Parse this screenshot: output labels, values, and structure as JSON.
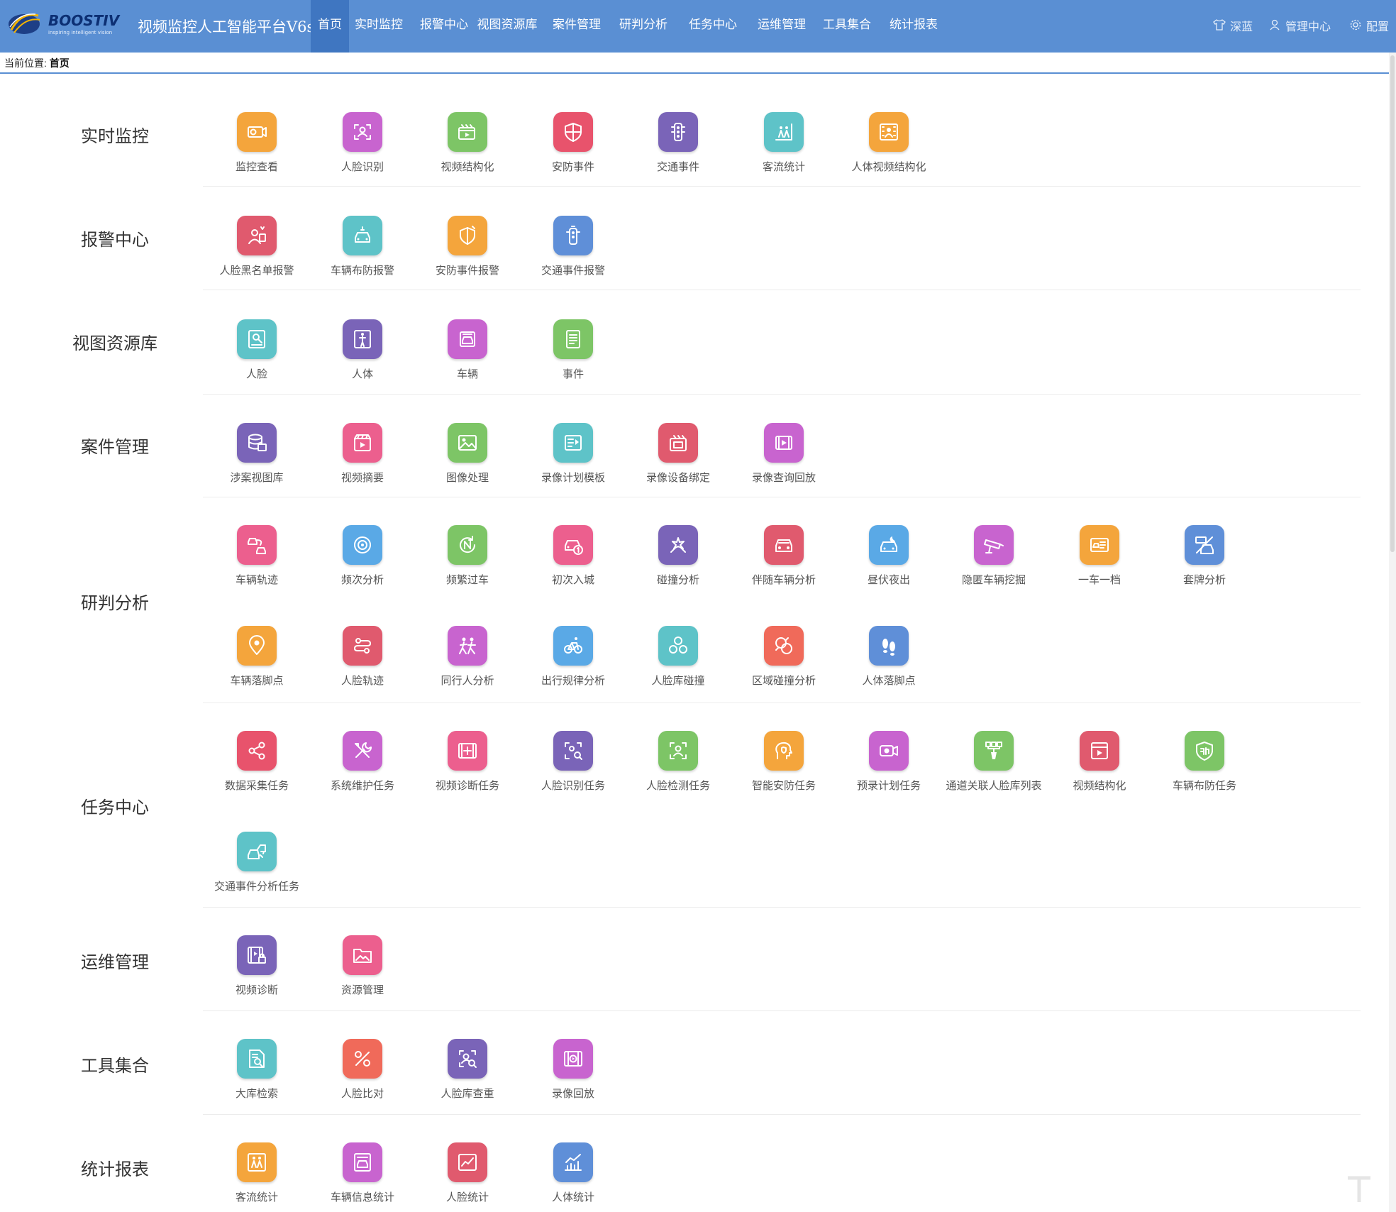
{
  "app": {
    "logo_text": "BOOSTIV",
    "logo_tagline": "inspiring intelligent vision",
    "title": "视频监控人工智能平台V6s"
  },
  "nav": {
    "tabs": [
      "首页",
      "实时监控",
      "报警中心",
      "视图资源库",
      "案件管理",
      "研判分析",
      "任务中心",
      "运维管理",
      "工具集合",
      "统计报表"
    ],
    "active_index": 0
  },
  "top_links": [
    {
      "label": "深蓝",
      "icon": "shirt-icon"
    },
    {
      "label": "管理中心",
      "icon": "user-icon"
    },
    {
      "label": "配置",
      "icon": "gear-icon"
    }
  ],
  "breadcrumb": {
    "prefix": "当前位置:",
    "current": "首页"
  },
  "colors": {
    "topbar": "#5a8fd3",
    "active_tab": "#3f76c1"
  },
  "sections": [
    {
      "title": "实时监控",
      "items": [
        {
          "label": "监控查看",
          "color": "#f4a53c",
          "icon": "camera-icon"
        },
        {
          "label": "人脸识别",
          "color": "#c864cf",
          "icon": "face-scan-icon"
        },
        {
          "label": "视频结构化",
          "color": "#7dc566",
          "icon": "video-structure-icon"
        },
        {
          "label": "安防事件",
          "color": "#e8536c",
          "icon": "shield-icon"
        },
        {
          "label": "交通事件",
          "color": "#7a64b8",
          "icon": "traffic-light-icon"
        },
        {
          "label": "客流统计",
          "color": "#5ec3c8",
          "icon": "crowd-icon"
        },
        {
          "label": "人体视频结构化",
          "color": "#f4a53c",
          "icon": "person-grid-icon"
        }
      ]
    },
    {
      "title": "报警中心",
      "items": [
        {
          "label": "人脸黑名单报警",
          "color": "#e05a6e",
          "icon": "person-alarm-icon"
        },
        {
          "label": "车辆布防报警",
          "color": "#5ec3c8",
          "icon": "car-alarm-icon"
        },
        {
          "label": "安防事件报警",
          "color": "#f4a53c",
          "icon": "shield-alarm-icon"
        },
        {
          "label": "交通事件报警",
          "color": "#5f8fd8",
          "icon": "traffic-alarm-icon"
        }
      ]
    },
    {
      "title": "视图资源库",
      "items": [
        {
          "label": "人脸",
          "color": "#5ec3c8",
          "icon": "face-card-icon"
        },
        {
          "label": "人体",
          "color": "#7a64b8",
          "icon": "person-body-icon"
        },
        {
          "label": "车辆",
          "color": "#c864cf",
          "icon": "vehicle-icon"
        },
        {
          "label": "事件",
          "color": "#7dc566",
          "icon": "list-icon"
        }
      ]
    },
    {
      "title": "案件管理",
      "items": [
        {
          "label": "涉案视图库",
          "color": "#7a64b8",
          "icon": "database-icon"
        },
        {
          "label": "视频摘要",
          "color": "#ec5f8e",
          "icon": "clapper-icon"
        },
        {
          "label": "图像处理",
          "color": "#7dc566",
          "icon": "image-icon"
        },
        {
          "label": "录像计划模板",
          "color": "#5ec3c8",
          "icon": "template-icon"
        },
        {
          "label": "录像设备绑定",
          "color": "#e05a6e",
          "icon": "device-bind-icon"
        },
        {
          "label": "录像查询回放",
          "color": "#c864cf",
          "icon": "film-play-icon"
        }
      ]
    },
    {
      "title": "研判分析",
      "items": [
        {
          "label": "车辆轨迹",
          "color": "#ec5f8e",
          "icon": "car-track-icon"
        },
        {
          "label": "频次分析",
          "color": "#5aa9e6",
          "icon": "frequency-icon"
        },
        {
          "label": "频繁过车",
          "color": "#7dc566",
          "icon": "n-cycle-icon"
        },
        {
          "label": "初次入城",
          "color": "#ec5f8e",
          "icon": "car-first-icon"
        },
        {
          "label": "碰撞分析",
          "color": "#7a64b8",
          "icon": "collision-icon"
        },
        {
          "label": "伴随车辆分析",
          "color": "#e05a6e",
          "icon": "car-follow-icon"
        },
        {
          "label": "昼伏夜出",
          "color": "#5aa9e6",
          "icon": "car-night-icon"
        },
        {
          "label": "隐匿车辆挖掘",
          "color": "#c864cf",
          "icon": "cctv-icon"
        },
        {
          "label": "一车一档",
          "color": "#f4a53c",
          "icon": "car-file-icon"
        },
        {
          "label": "套牌分析",
          "color": "#5f8fd8",
          "icon": "fake-plate-icon"
        },
        {
          "label": "车辆落脚点",
          "color": "#f4a53c",
          "icon": "location-pin-icon"
        },
        {
          "label": "人脸轨迹",
          "color": "#e05a6e",
          "icon": "face-track-icon"
        },
        {
          "label": "同行人分析",
          "color": "#c864cf",
          "icon": "companions-icon"
        },
        {
          "label": "出行规律分析",
          "color": "#5aa9e6",
          "icon": "bicycle-icon"
        },
        {
          "label": "人脸库碰撞",
          "color": "#5ec3c8",
          "icon": "face-group-icon"
        },
        {
          "label": "区域碰撞分析",
          "color": "#f06a5a",
          "icon": "area-collision-icon"
        },
        {
          "label": "人体落脚点",
          "color": "#5f8fd8",
          "icon": "footprints-icon"
        }
      ]
    },
    {
      "title": "任务中心",
      "items": [
        {
          "label": "数据采集任务",
          "color": "#e8536c",
          "icon": "share-nodes-icon"
        },
        {
          "label": "系统维护任务",
          "color": "#c864cf",
          "icon": "tools-icon"
        },
        {
          "label": "视频诊断任务",
          "color": "#ec5f8e",
          "icon": "video-diag-icon"
        },
        {
          "label": "人脸识别任务",
          "color": "#7a64b8",
          "icon": "face-search-icon"
        },
        {
          "label": "人脸检测任务",
          "color": "#7dc566",
          "icon": "face-detect-icon"
        },
        {
          "label": "智能安防任务",
          "color": "#f4a53c",
          "icon": "head-shield-icon"
        },
        {
          "label": "预录计划任务",
          "color": "#c864cf",
          "icon": "video-record-icon"
        },
        {
          "label": "通道关联人脸库列表",
          "color": "#7dc566",
          "icon": "channel-link-icon"
        },
        {
          "label": "视频结构化",
          "color": "#e05a6e",
          "icon": "video-frame-icon"
        },
        {
          "label": "车辆布防任务",
          "color": "#7dc566",
          "icon": "defense-badge-icon"
        },
        {
          "label": "交通事件分析任务",
          "color": "#5ec3c8",
          "icon": "car-crash-icon"
        }
      ]
    },
    {
      "title": "运维管理",
      "items": [
        {
          "label": "视频诊断",
          "color": "#7a64b8",
          "icon": "film-lock-icon"
        },
        {
          "label": "资源管理",
          "color": "#ec5f8e",
          "icon": "folder-image-icon"
        }
      ]
    },
    {
      "title": "工具集合",
      "items": [
        {
          "label": "大库检索",
          "color": "#5ec3c8",
          "icon": "doc-search-icon"
        },
        {
          "label": "人脸比对",
          "color": "#f06a5a",
          "icon": "percent-icon"
        },
        {
          "label": "人脸库查重",
          "color": "#7a64b8",
          "icon": "face-dup-icon"
        },
        {
          "label": "录像回放",
          "color": "#c864cf",
          "icon": "film-playback-icon"
        }
      ]
    },
    {
      "title": "统计报表",
      "items": [
        {
          "label": "客流统计",
          "color": "#f4a53c",
          "icon": "crowd-stat-icon"
        },
        {
          "label": "车辆信息统计",
          "color": "#c864cf",
          "icon": "car-stat-icon"
        },
        {
          "label": "人脸统计",
          "color": "#e05a6e",
          "icon": "face-stat-icon"
        },
        {
          "label": "人体统计",
          "color": "#5f8fd8",
          "icon": "body-stat-icon"
        }
      ]
    }
  ]
}
